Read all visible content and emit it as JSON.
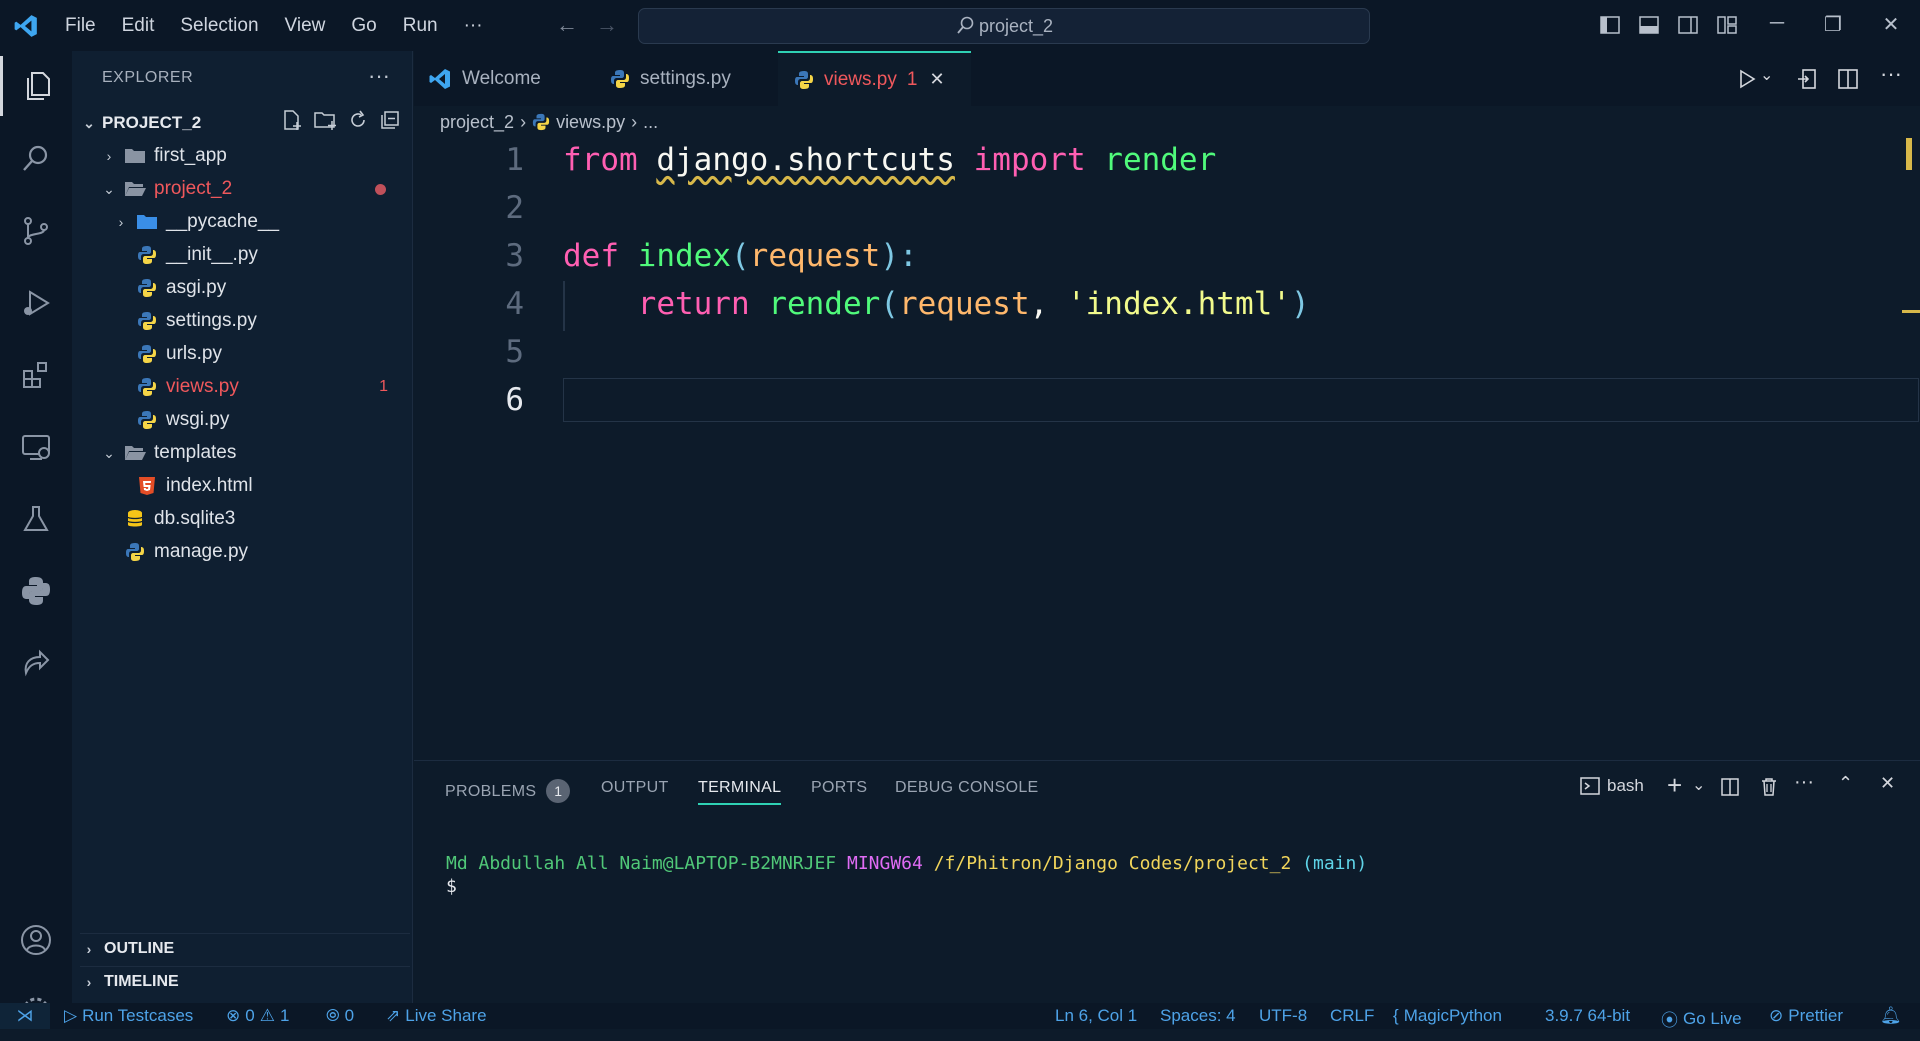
{
  "menu": [
    "File",
    "Edit",
    "Selection",
    "View",
    "Go",
    "Run",
    "···"
  ],
  "search": "project_2",
  "explorer": {
    "title": "EXPLORER",
    "project": "PROJECT_2",
    "tree": [
      {
        "name": "first_app",
        "type": "folder"
      },
      {
        "name": "project_2",
        "type": "folder-open"
      },
      {
        "name": "__pycache__",
        "type": "folder"
      },
      {
        "name": "__init__.py",
        "type": "python"
      },
      {
        "name": "asgi.py",
        "type": "python"
      },
      {
        "name": "settings.py",
        "type": "python"
      },
      {
        "name": "urls.py",
        "type": "python"
      },
      {
        "name": "views.py",
        "type": "python",
        "badge": "1"
      },
      {
        "name": "wsgi.py",
        "type": "python"
      },
      {
        "name": "templates",
        "type": "folder-open"
      },
      {
        "name": "index.html",
        "type": "html"
      },
      {
        "name": "db.sqlite3",
        "type": "database"
      },
      {
        "name": "manage.py",
        "type": "python"
      }
    ],
    "outline": "OUTLINE",
    "timeline": "TIMELINE"
  },
  "tabs": [
    {
      "label": "Welcome"
    },
    {
      "label": "settings.py"
    },
    {
      "label": "views.py",
      "badge": "1"
    }
  ],
  "breadcrumb": {
    "folder": "project_2",
    "file": "views.py",
    "rest": "..."
  },
  "code": {
    "line_numbers": [
      "1",
      "2",
      "3",
      "4",
      "5",
      "6"
    ],
    "l1": {
      "from": "from",
      "module": "django.shortcuts",
      "import": "import",
      "name": "render"
    },
    "l3": {
      "def": "def",
      "fn": "index",
      "open": "(",
      "param": "request",
      "close": "):"
    },
    "l4": {
      "ret": "return",
      "call": "render",
      "open": "(",
      "arg1": "request",
      ",": ",",
      "str": "'index.html'",
      "close": ")"
    }
  },
  "panel": {
    "tabs": [
      "PROBLEMS",
      "OUTPUT",
      "TERMINAL",
      "PORTS",
      "DEBUG CONSOLE"
    ],
    "problems_count": "1",
    "shell": "bash",
    "prompt_user": "Md Abdullah All Naim@LAPTOP-B2MNRJEF",
    "prompt_env": "MINGW64",
    "prompt_path": "/f/Phitron/Django Codes/project_2",
    "prompt_branch": "(main)",
    "prompt_symbol": "$"
  },
  "status": {
    "run_testcases": "Run Testcases",
    "errors": "0",
    "warnings": "1",
    "ports": "0",
    "live_share": "Live Share",
    "position": "Ln 6, Col 1",
    "spaces": "Spaces: 4",
    "encoding": "UTF-8",
    "eol": "CRLF",
    "language": "MagicPython",
    "interpreter": "3.9.7 64-bit",
    "go_live": "Go Live",
    "prettier": "Prettier"
  },
  "colors": {
    "accent": "#2fd1b4",
    "error": "#f0585c",
    "status_text": "#4ea3e8"
  }
}
